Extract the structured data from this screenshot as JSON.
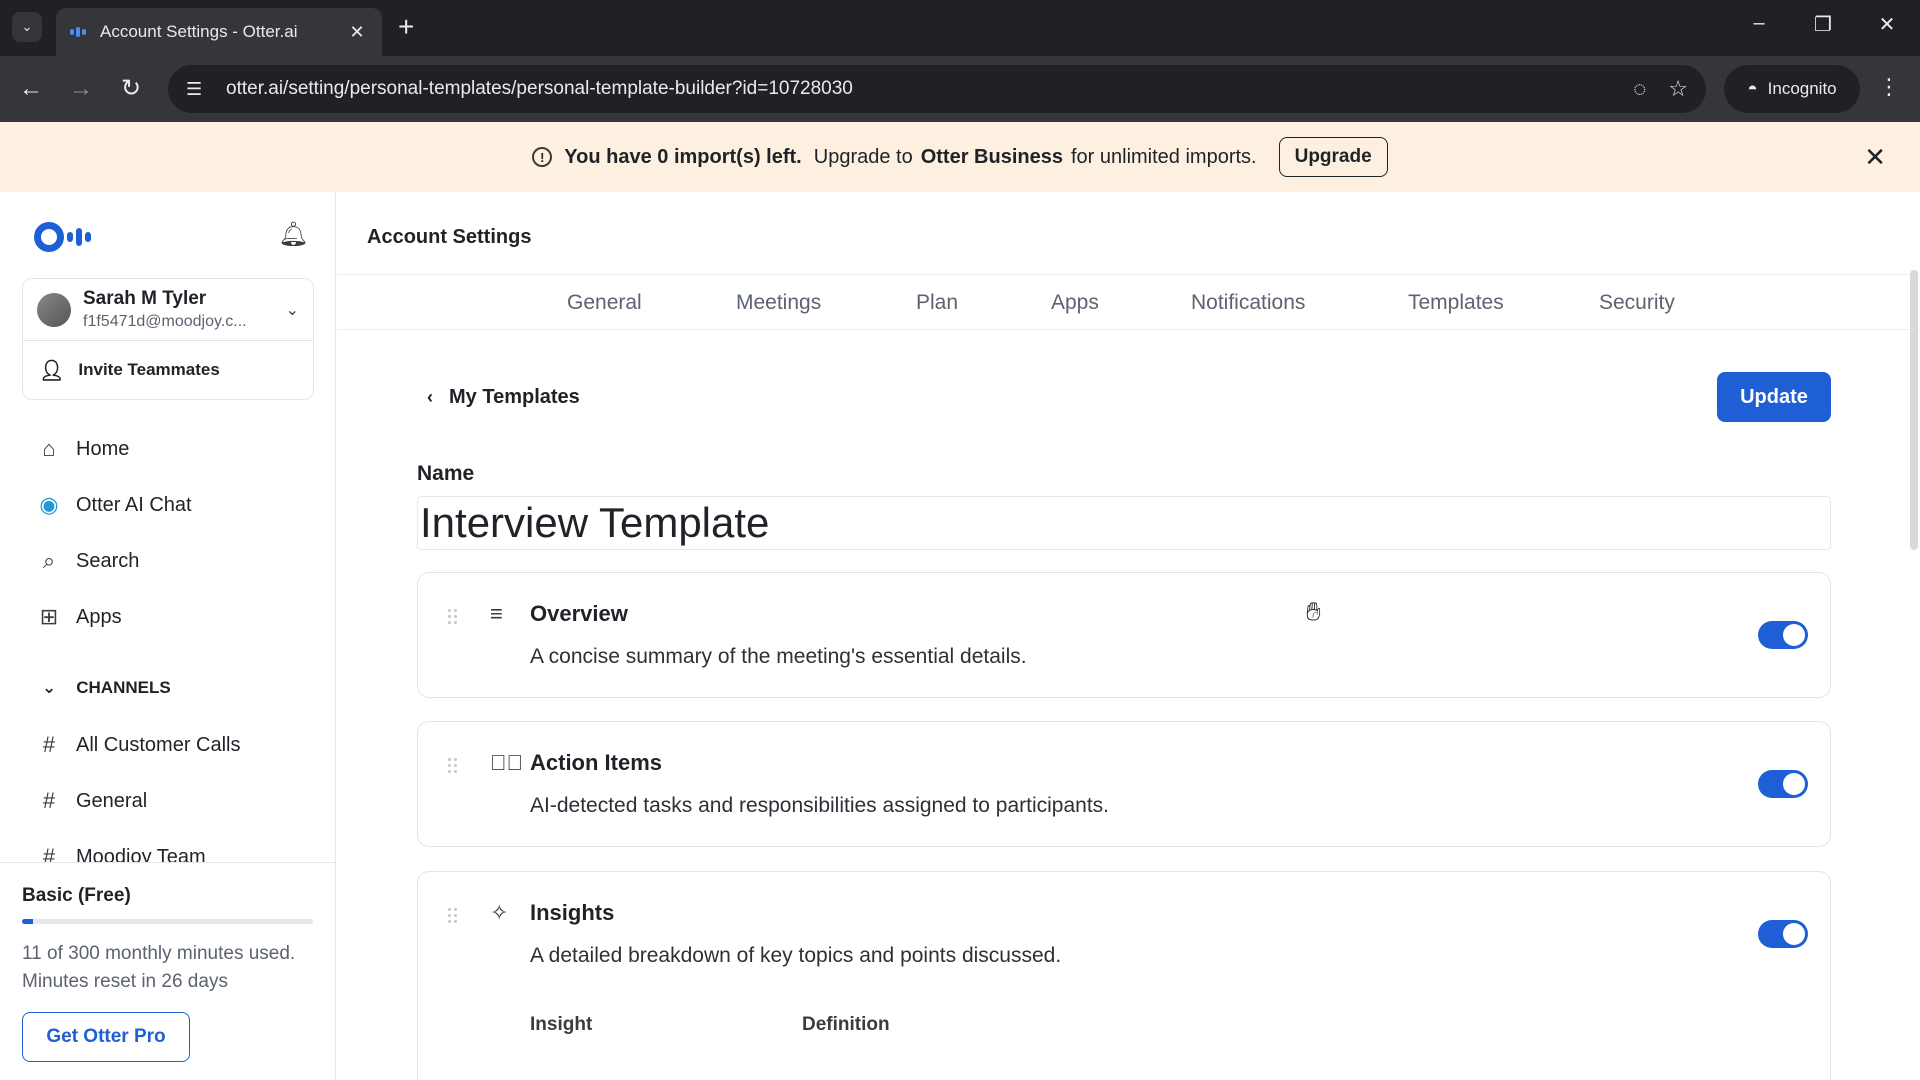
{
  "browser": {
    "tab_title": "Account Settings - Otter.ai",
    "url": "otter.ai/setting/personal-templates/personal-template-builder?id=10728030",
    "incognito_label": "Incognito"
  },
  "banner": {
    "strong_text": "You have 0 import(s) left.",
    "pre_text": "Upgrade to",
    "product": "Otter Business",
    "post_text": "for unlimited imports.",
    "button_label": "Upgrade"
  },
  "sidebar": {
    "user": {
      "name": "Sarah M Tyler",
      "email": "f1f5471d@moodjoy.c..."
    },
    "invite_label": "Invite Teammates",
    "nav": [
      {
        "label": "Home"
      },
      {
        "label": "Otter AI Chat"
      },
      {
        "label": "Search"
      },
      {
        "label": "Apps"
      }
    ],
    "channels_header": "CHANNELS",
    "channels": [
      {
        "label": "All Customer Calls"
      },
      {
        "label": "General"
      },
      {
        "label": "Moodjoy Team"
      }
    ],
    "plan": {
      "name": "Basic (Free)",
      "minutes_used": 11,
      "minutes_total": 300,
      "usage_fraction": 0.037,
      "usage_text": "11 of 300 monthly minutes used.",
      "reset_text": "Minutes reset in 26 days",
      "cta_label": "Get Otter Pro"
    }
  },
  "main": {
    "page_title": "Account Settings",
    "tabs": [
      {
        "label": "General"
      },
      {
        "label": "Meetings"
      },
      {
        "label": "Plan"
      },
      {
        "label": "Apps"
      },
      {
        "label": "Notifications"
      },
      {
        "label": "Templates"
      },
      {
        "label": "Security"
      }
    ],
    "back_label": "My Templates",
    "update_label": "Update",
    "name_label": "Name",
    "name_value": "Interview Template",
    "sections": [
      {
        "title": "Overview",
        "description": "A concise summary of the meeting's essential details.",
        "enabled": true
      },
      {
        "title": "Action Items",
        "description": "AI-detected tasks and responsibilities assigned to participants.",
        "enabled": true
      },
      {
        "title": "Insights",
        "description": "A detailed breakdown of key topics and points discussed.",
        "enabled": true
      }
    ],
    "insights_columns": [
      "Insight",
      "Definition"
    ]
  },
  "colors": {
    "accent": "#1f5fd6",
    "banner_bg": "#fdf0e0"
  }
}
